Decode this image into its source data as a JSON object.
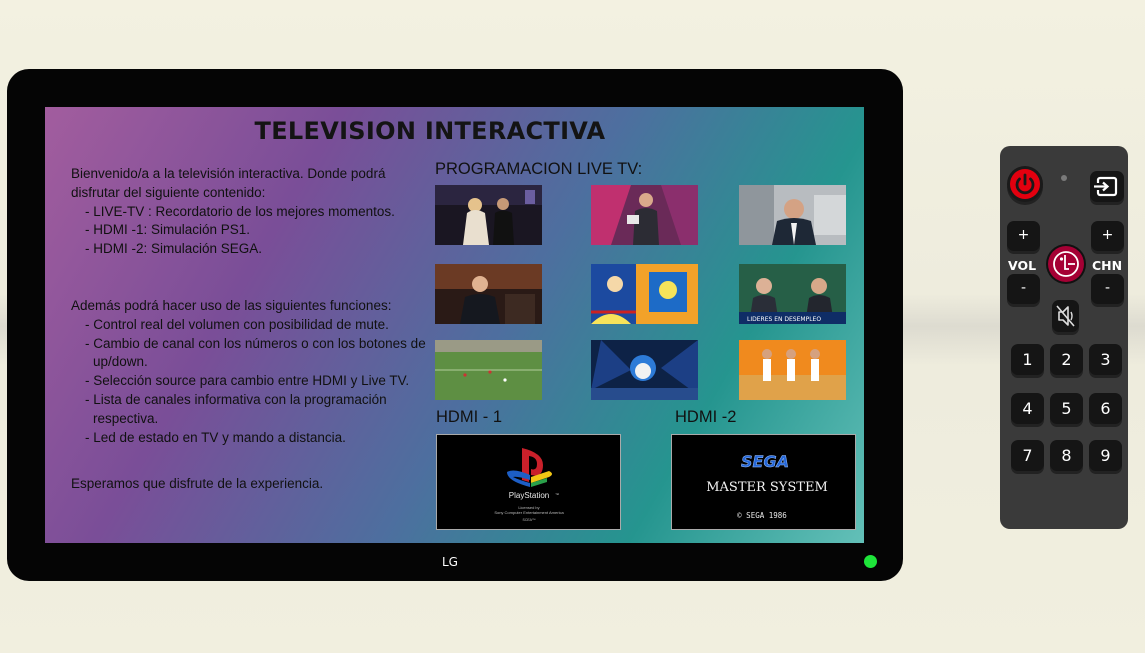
{
  "screen": {
    "title": "TELEVISION INTERACTIVA",
    "intro": "Bienvenido/a a la televisión interactiva. Donde podrá disfrutar del siguiente contenido:",
    "content_items": [
      "- LIVE-TV : Recordatorio de los mejores momentos.",
      "- HDMI -1: Simulación PS1.",
      "- HDMI -2: Simulación SEGA."
    ],
    "functions_intro": "Además podrá hacer uso de las siguientes funciones:",
    "function_items": [
      "- Control real del volumen con posibilidad de mute.",
      "- Cambio de canal con los números o con los botones de up/down.",
      "- Selección source para cambio entre HDMI y Live TV.",
      "- Lista de canales informativa con la programación respectiva.",
      "- Led de estado en TV y mando a distancia."
    ],
    "closing": "Esperamos que disfrute de la experiencia.",
    "live_tv_label": "PROGRAMACION LIVE TV:",
    "hdmi1_label": "HDMI - 1",
    "hdmi2_label": "HDMI -2",
    "hdmi1": {
      "logo_text": "PlayStation",
      "tm": "™",
      "licensed_line1": "Licensed by",
      "licensed_line2": "Sony Computer Entertainment America",
      "scea": "SCEA™"
    },
    "hdmi2": {
      "brand": "SEGA",
      "product": "MASTER SYSTEM",
      "copyright": "© SEGA 1986"
    },
    "thumbnail_caption": "LIDERES EN DESEMPLEO"
  },
  "tv": {
    "brand": "LG",
    "led_color": "#1ee53a"
  },
  "remote": {
    "vol_label": "VOL",
    "chn_label": "CHN",
    "plus": "+",
    "minus": "-",
    "numbers": [
      "1",
      "2",
      "3",
      "4",
      "5",
      "6",
      "7",
      "8",
      "9"
    ],
    "logo": "LG",
    "power_color": "#e3000f",
    "logo_color": "#a50034"
  }
}
